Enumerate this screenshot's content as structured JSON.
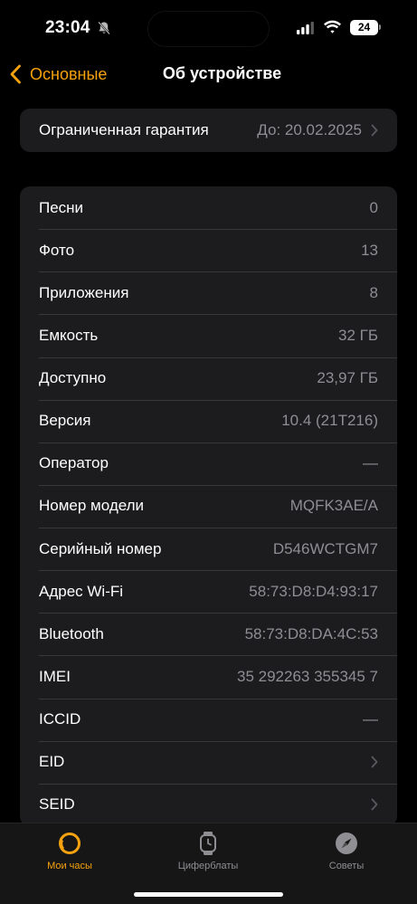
{
  "status_bar": {
    "time": "23:04",
    "battery": "24",
    "icons": [
      "bell-slash-icon",
      "signal-icon",
      "wifi-icon",
      "battery-icon"
    ]
  },
  "nav": {
    "back_label": "Основные",
    "title": "Об устройстве"
  },
  "warranty": {
    "label": "Ограниченная гарантия",
    "value": "До: 20.02.2025"
  },
  "info_rows": [
    {
      "label": "Песни",
      "value": "0"
    },
    {
      "label": "Фото",
      "value": "13"
    },
    {
      "label": "Приложения",
      "value": "8"
    },
    {
      "label": "Емкость",
      "value": "32 ГБ"
    },
    {
      "label": "Доступно",
      "value": "23,97 ГБ"
    },
    {
      "label": "Версия",
      "value": "10.4 (21T216)"
    },
    {
      "label": "Оператор",
      "value": "—"
    },
    {
      "label": "Номер модели",
      "value": "MQFK3AE/A"
    },
    {
      "label": "Серийный номер",
      "value": "D546WCTGM7"
    },
    {
      "label": "Адрес Wi-Fi",
      "value": "58:73:D8:D4:93:17"
    },
    {
      "label": "Bluetooth",
      "value": "58:73:D8:DA:4C:53"
    },
    {
      "label": "IMEI",
      "value": "35 292263 355345 7"
    },
    {
      "label": "ICCID",
      "value": "—"
    },
    {
      "label": "EID",
      "value": ""
    },
    {
      "label": "SEID",
      "value": ""
    }
  ],
  "tab_bar": {
    "tabs": [
      {
        "label": "Мои часы",
        "icon": "watch-face-icon",
        "active": true
      },
      {
        "label": "Циферблаты",
        "icon": "watch-icon",
        "active": false
      },
      {
        "label": "Советы",
        "icon": "compass-icon",
        "active": false
      }
    ]
  },
  "colors": {
    "accent": "#f6a20e",
    "background": "#000000",
    "group_background": "#1c1c1e",
    "secondary_text": "#8e8e93",
    "separator": "#38383a"
  }
}
